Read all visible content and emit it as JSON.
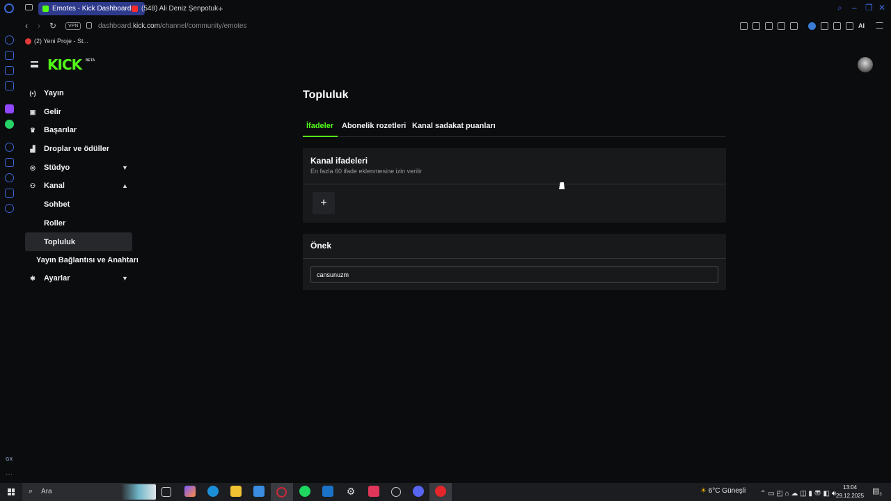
{
  "browser": {
    "tabs": [
      {
        "title": "Emotes - Kick Dashboard",
        "active": true
      },
      {
        "title": "(548) Ali Deniz Şenpotuk",
        "active": false
      }
    ],
    "new_tab_symbol": "+",
    "url_host": "dashboard.",
    "url_domain": "kick.com",
    "url_path": "/channel/community/emotes",
    "vpn_label": "VPN",
    "ai_label": "AI",
    "bookmark": "(2) Yeni Proje - St..."
  },
  "rail": {
    "gx_label": "GX",
    "more_label": "···"
  },
  "app": {
    "logo_text": "KICK",
    "logo_beta": "BETA",
    "sidebar": {
      "items": [
        {
          "label": "Yayın",
          "icon": "broadcast-icon",
          "glyph": "(•)"
        },
        {
          "label": "Gelir",
          "icon": "revenue-icon",
          "glyph": "▣"
        },
        {
          "label": "Başarılar",
          "icon": "trophy-icon",
          "glyph": "♛"
        },
        {
          "label": "Droplar ve ödüller",
          "icon": "gift-icon",
          "glyph": "▟"
        },
        {
          "label": "Stüdyo",
          "icon": "studio-icon",
          "glyph": "◎",
          "chevron": "▼"
        },
        {
          "label": "Kanal",
          "icon": "channel-icon",
          "glyph": "⚇",
          "chevron": "▲"
        },
        {
          "label": "Sohbet"
        },
        {
          "label": "Roller"
        },
        {
          "label": "Topluluk"
        },
        {
          "label": "Yayın Bağlantısı ve Anahtarı"
        },
        {
          "label": "Ayarlar",
          "icon": "settings-icon",
          "glyph": "✱",
          "chevron": "▼"
        }
      ]
    },
    "page_title": "Topluluk",
    "tabs": [
      {
        "label": "İfadeler",
        "active": true
      },
      {
        "label": "Abonelik rozetleri",
        "active": false
      },
      {
        "label": "Kanal sadakat puanları",
        "active": false
      }
    ],
    "emotes_card": {
      "title": "Kanal ifadeleri",
      "subtitle": "En fazla 60 ifade eklenmesine izin verilir",
      "add_symbol": "+"
    },
    "prefix_card": {
      "title": "Önek",
      "value": "cansunuzm"
    }
  },
  "taskbar": {
    "search_placeholder": "Ara",
    "weather": "6°C  Güneşli",
    "time": "13:04",
    "date": "29.12.2025",
    "notification_count": "3"
  },
  "colors": {
    "accent": "#53fc18",
    "tab_active": "#2e3a8c",
    "card": "#18191b"
  }
}
